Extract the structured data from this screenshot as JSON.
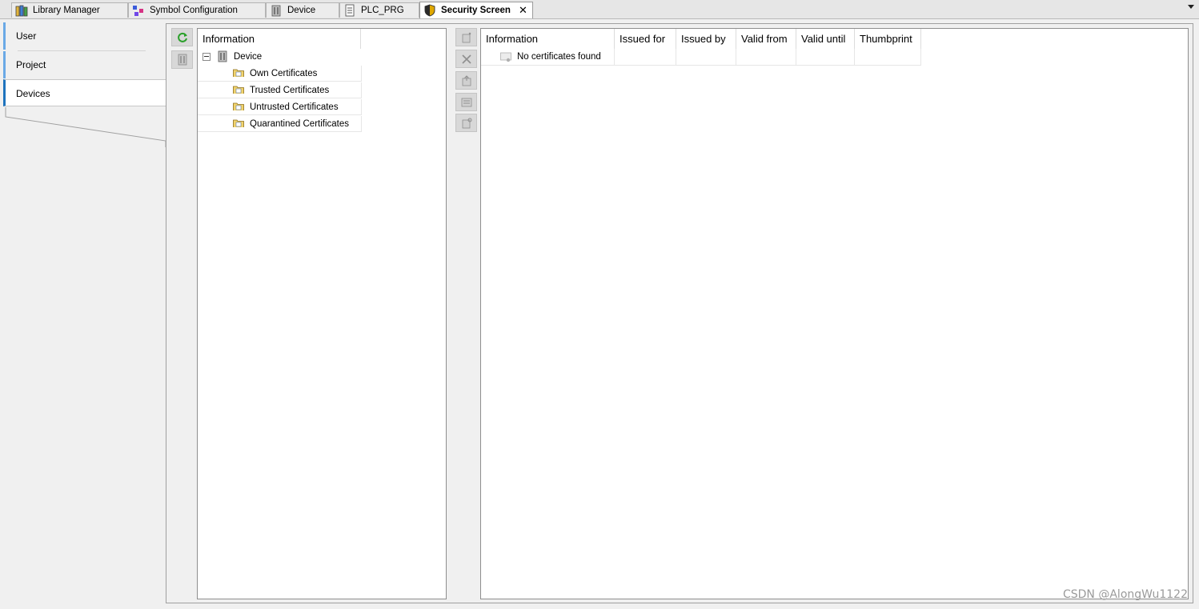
{
  "tabs": [
    {
      "label": "Library Manager",
      "icon": "library-icon"
    },
    {
      "label": "Symbol Configuration",
      "icon": "symbol-config-icon"
    },
    {
      "label": "Device",
      "icon": "device-icon"
    },
    {
      "label": "PLC_PRG",
      "icon": "document-icon"
    },
    {
      "label": "Security Screen",
      "icon": "shield-icon",
      "active": true,
      "close": "✕"
    }
  ],
  "sidebar": {
    "items": [
      {
        "label": "User"
      },
      {
        "label": "Project"
      },
      {
        "label": "Devices",
        "selected": true
      }
    ]
  },
  "tree": {
    "header": "Information",
    "root": "Device",
    "children": [
      "Own Certificates",
      "Trusted Certificates",
      "Untrusted Certificates",
      "Quarantined Certificates"
    ]
  },
  "certs": {
    "columns": [
      "Information",
      "Issued for",
      "Issued by",
      "Valid from",
      "Valid until",
      "Thumbprint"
    ],
    "empty_message": "No certificates found"
  },
  "watermark": "CSDN @AlongWu1122",
  "colors": {
    "accent": "#1e73be",
    "refresh_green": "#2aa02a",
    "folder_yellow": "#f2d36b"
  }
}
